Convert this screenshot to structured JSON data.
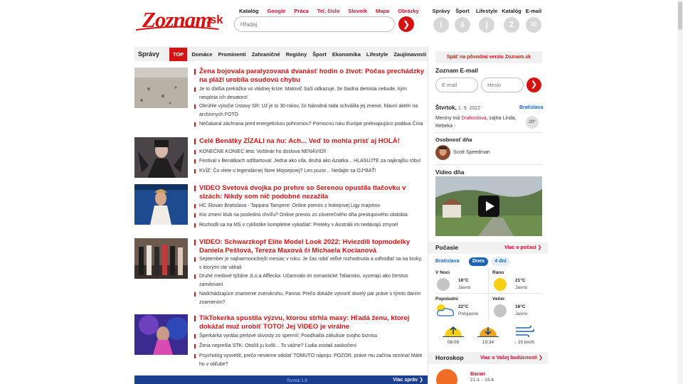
{
  "header": {
    "logo": "Zoznam.sk",
    "logo_main": "Zoznam",
    "logo_suffix": ".sk",
    "links": [
      "Katalóg",
      "Google",
      "Práca",
      "Tel. číslo",
      "Slovník",
      "Mapa",
      "Obrázky"
    ],
    "search_placeholder": "Hľadaj",
    "services": [
      {
        "label": "Správy",
        "icon": "info-icon",
        "glyph": "i"
      },
      {
        "label": "Šport",
        "icon": "sport-icon",
        "glyph": "š"
      },
      {
        "label": "Lifestyle",
        "icon": "lifestyle-icon",
        "glyph": "|"
      },
      {
        "label": "Katalóg",
        "icon": "catalog-icon",
        "glyph": "Z"
      },
      {
        "label": "E-mail",
        "icon": "mail-icon",
        "glyph": "✉"
      }
    ]
  },
  "nav": {
    "section": "Správy",
    "items": [
      "TOP",
      "Domáce",
      "Prominenti",
      "Zahraničné",
      "Regióny",
      "Šport",
      "Ekonomika",
      "Lifestyle",
      "Zaujímavosti"
    ]
  },
  "articles": [
    {
      "headline": "Žena bojovala paralyzovaná dvanásť hodín o život: Počas prechádzky na pláži urobila osudovú chybu",
      "subs": [
        "Je to ďalšia prekážka vo vládnej kríze: Matovič SaS odkazuje, že žiadna demisia nebude, kým nesplnia ich desatoro!",
        "Okrúhle výročie Ústavy SR: Už je to 30 rokov, čo Národná rada schválila jej znenie, hlavní aktéri na archívnych FOTO",
        "Nečakaná záchrana pred energetickou pohromou? Pomocnú ruku Európe prekvapujúco podáva Čína"
      ]
    },
    {
      "headline": "Celé Benátky ZÍZALI na ňu: Ach... Veď to mohla prísť aj HOLÁ!",
      "subs": [
        "KONEČNE KONIEC leta: Voštinár ho doslova NENÁVIDÍ!",
        "Festival v Benátkach odštartoval: Jedna ako víla, druhá ako Aziatka... HLASUJTE za najkrajšiu róbu!",
        "KVÍZ: Čo viete o legendárnej Nore Mojsejovej? Len pozor... Nedajte sa OJ*BAŤ!"
      ]
    },
    {
      "headline": "VIDEO Svetová dvojka po prehre so Serenou opustila tlačovku v slzách: Nikdy som nič podobné nezažila",
      "subs": [
        "HC Slovan Bratislava - Tappara Tampere: Online prenos z hokejovej Ligy majstrov",
        "Kto zmení klub na poslednú chvíľu? Online prenos zo záverečného dňa prestupového obdobia",
        "Rozhodli sa na MS v cyklistike kompletne vykašlať: Preteky v Austrálii im nedávajú zmysel"
      ]
    },
    {
      "headline": "VIDEO: Schwarzkopf Elite Model Look 2022: Hviezdili topmodelky Daniela Peštová, Tereza Maxová či Michaela Kocianová",
      "subs": [
        "September je najharmonickejší mesiac v roku: Je čas robiť veľké rozhodnutia a odhodlať sa na kroky, s ktorými ste váhali",
        "Druhé medové týždne JLo a Afflecka: Učarovalo im romantické Taliansko, vyzerajú ako čerstvo zamilovaní",
        "Nadchádzajúce znamenie zverokruhu, Panna: Prečo dokáže vytvoriť skvelý pár práve s týmto daním znamením?"
      ]
    },
    {
      "headline": "TikTokerka spustila výzvu, ktorou strhla masy: Hľadá ženu, ktorej dokážal muž urobiť TOTO! Jej VIDEO je virálne",
      "subs": [
        "Šperkárka vyrába perlové skvosty zo spermií: Poodhalila zákulisie svojho biznisu",
        "Žena neprešla STK: Otočili ju kvôli....To vážne? Ľudia zostali zaskočení",
        "Psychológ vysvetlil, prečo nevieme odolať TOMUTO nápoju: POZOR, práve mu začína sezóna! Máte ho v obľube?"
      ]
    }
  ],
  "banner": {
    "text": "Štvrtok 1.9.",
    "link": "Viac správ ❯"
  },
  "sidebar": {
    "back_link": "Späť na pôvodnú verziu Zoznam.sk",
    "email_title": "Zoznam E-mail",
    "email_placeholder": "E-mail",
    "password_placeholder": "Heslo",
    "day": "Štvrtok,",
    "date": "1. 9. 2022",
    "city": "Bratislava",
    "names_prefix": "Meniny má",
    "names_today": "Drahoslava",
    "names_rest": ", zajtra Linda, Rebeka -",
    "temp_badge": "20°",
    "person_title": "Osobnosť dňa",
    "person_name": "Scott Speedman",
    "video_title": "Video dňa"
  },
  "weather": {
    "title": "Počasie",
    "link": "Viac o počasí ❯",
    "city": "Bratislava",
    "tab_active": "Dnes",
    "tab_other": "4 dni",
    "periods": [
      {
        "name": "V Noci",
        "temp": "16°C",
        "desc": "Jasno",
        "icon": "cloud"
      },
      {
        "name": "Ráno",
        "temp": "21°C",
        "desc": "Jasno",
        "icon": "sun"
      },
      {
        "name": "Popoludní",
        "temp": "22°C",
        "desc": "Polojasno",
        "icon": "partly"
      },
      {
        "name": "Večer",
        "temp": "16°C",
        "desc": "Jasno",
        "icon": "cloud"
      }
    ],
    "sunrise": "06:09",
    "sunset": "19:34",
    "wind": "20 km/h"
  },
  "horoscope": {
    "title": "Horoskop",
    "link": "Viac o Vašej budúcnosti ❯",
    "sign": "Baran",
    "range": "21.3. - 19.4."
  },
  "colors": {
    "brand": "#d51313",
    "link_blue": "#1d64b3"
  }
}
